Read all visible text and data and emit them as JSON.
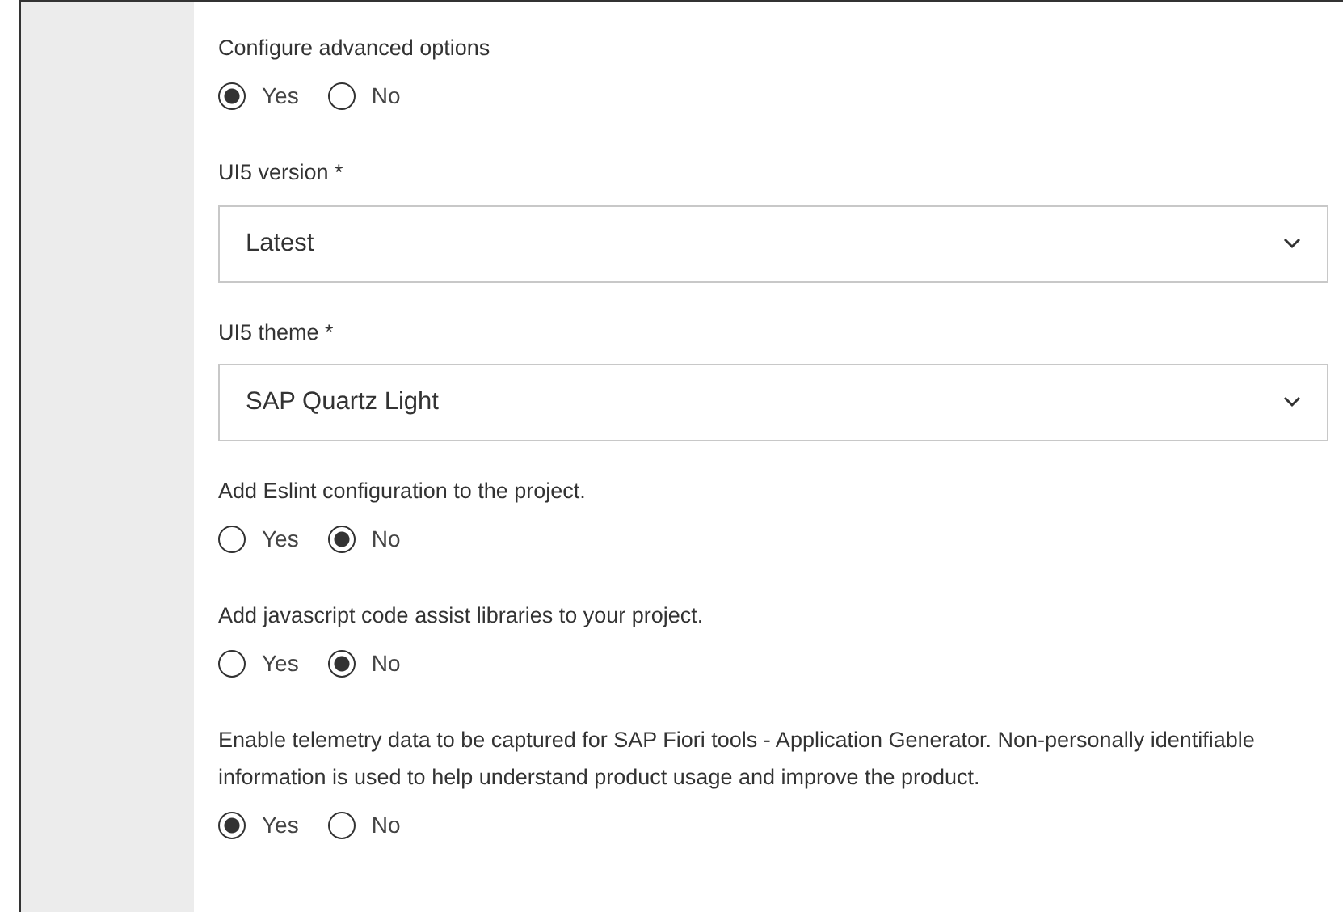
{
  "fields": [
    {
      "kind": "radio",
      "label": "Configure advanced options",
      "options": [
        {
          "label": "Yes",
          "selected": true
        },
        {
          "label": "No",
          "selected": false
        }
      ]
    },
    {
      "kind": "select",
      "label": "UI5 version *",
      "value": "Latest"
    },
    {
      "kind": "select",
      "label": "UI5 theme *",
      "value": "SAP Quartz Light"
    },
    {
      "kind": "radio",
      "label": "Add Eslint configuration to the project.",
      "options": [
        {
          "label": "Yes",
          "selected": false
        },
        {
          "label": "No",
          "selected": true
        }
      ]
    },
    {
      "kind": "radio",
      "label": "Add javascript code assist libraries to your project.",
      "options": [
        {
          "label": "Yes",
          "selected": false
        },
        {
          "label": "No",
          "selected": true
        }
      ]
    },
    {
      "kind": "radio",
      "label": "Enable telemetry data to be captured for SAP Fiori tools - Application Generator. Non-personally identifiable information is used to help understand product usage and improve the product.",
      "options": [
        {
          "label": "Yes",
          "selected": true
        },
        {
          "label": "No",
          "selected": false
        }
      ]
    }
  ]
}
